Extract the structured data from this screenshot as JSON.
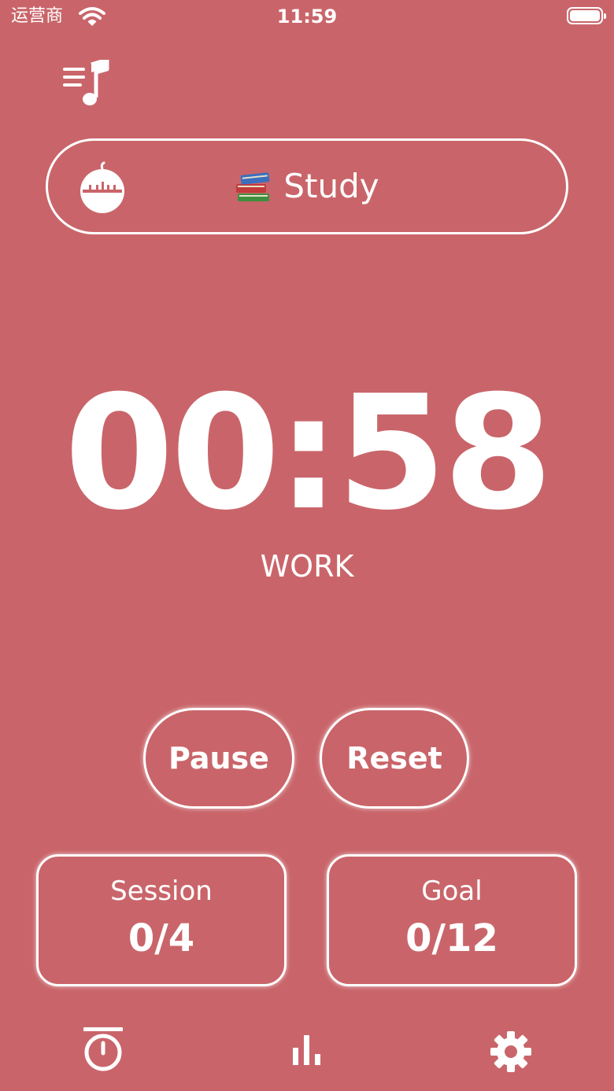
{
  "status_bar": {
    "carrier": "运营商",
    "time": "11:59"
  },
  "task": {
    "emoji_icon": "books-icon",
    "label": "Study"
  },
  "timer": {
    "time": "00:58",
    "mode": "WORK"
  },
  "controls": {
    "pause_label": "Pause",
    "reset_label": "Reset"
  },
  "stats": {
    "session_label": "Session",
    "session_value": "0/4",
    "goal_label": "Goal",
    "goal_value": "0/12"
  },
  "tab_bar": {
    "items": [
      "timer-icon",
      "stats-icon",
      "settings-icon"
    ]
  },
  "colors": {
    "background": "#c9656a",
    "foreground": "#ffffff"
  }
}
